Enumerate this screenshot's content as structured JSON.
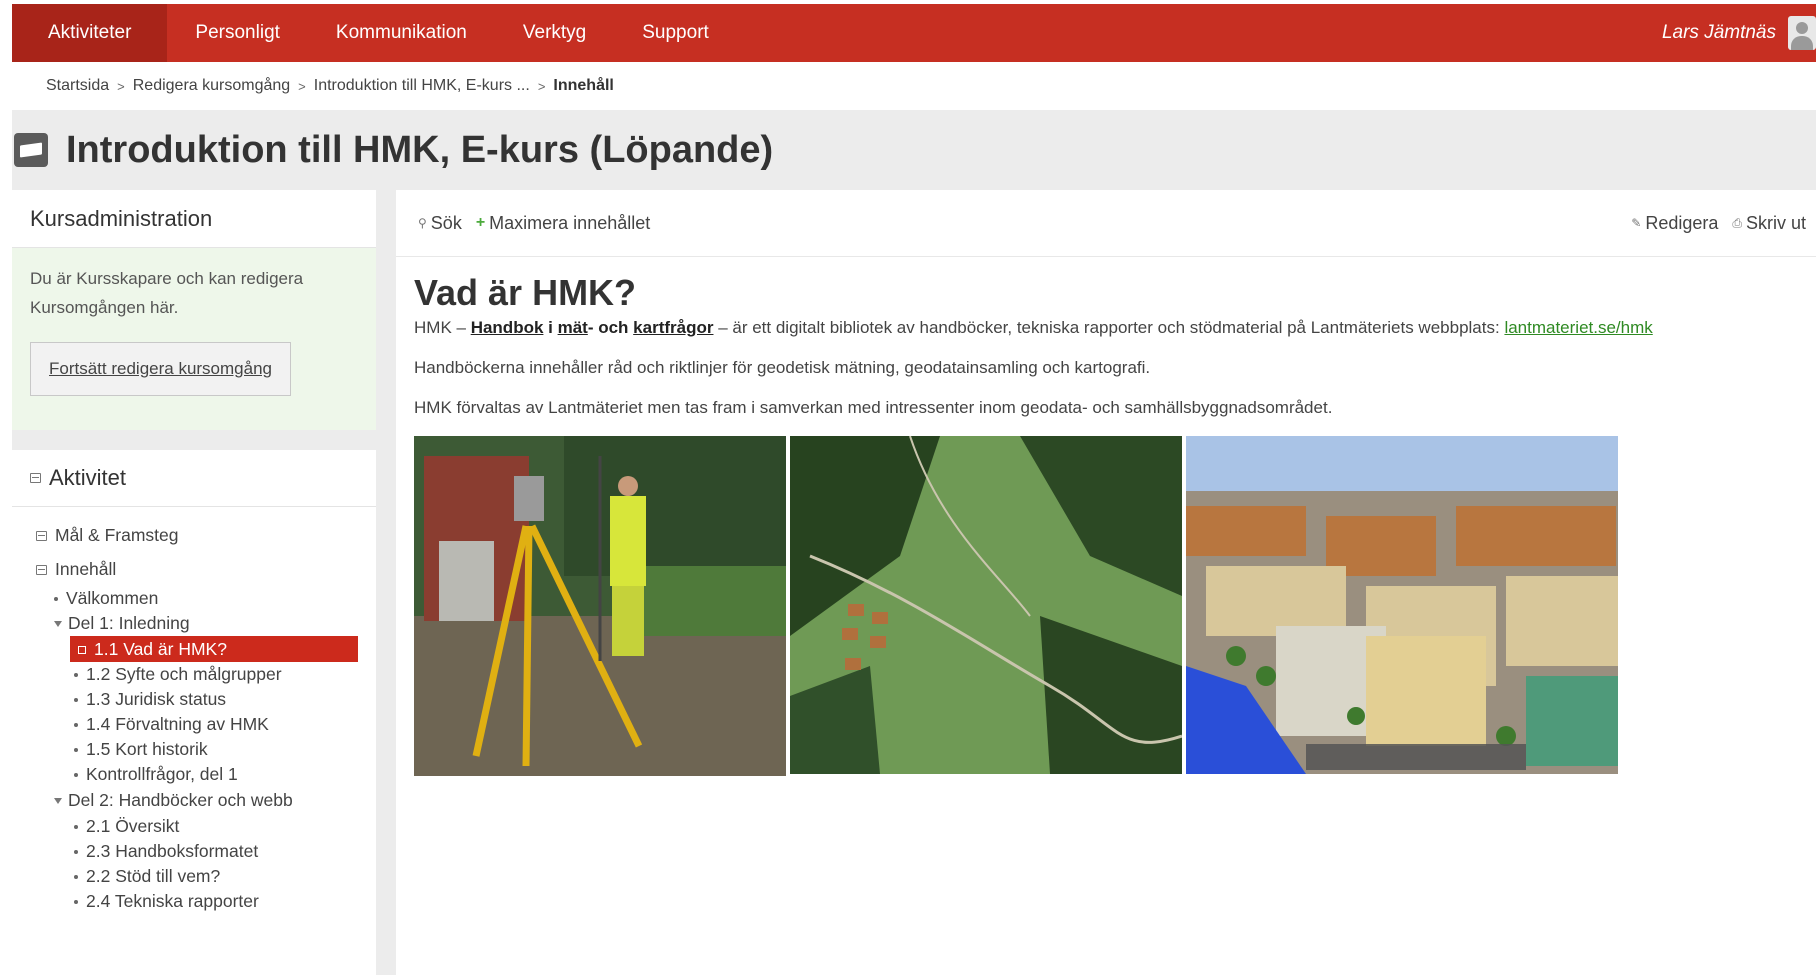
{
  "nav": {
    "items": [
      {
        "label": "Aktiviteter",
        "active": true
      },
      {
        "label": "Personligt"
      },
      {
        "label": "Kommunikation"
      },
      {
        "label": "Verktyg"
      },
      {
        "label": "Support"
      }
    ],
    "user_name": "Lars Jämtnäs",
    "accent_color": "#c62f22"
  },
  "breadcrumb": {
    "items": [
      "Startsida",
      "Redigera kursomgång",
      "Introduktion till HMK, E-kurs ..."
    ],
    "current": "Innehåll",
    "separator": ">"
  },
  "page": {
    "title": "Introduktion till HMK, E-kurs (Löpande)"
  },
  "admin": {
    "heading": "Kursadministration",
    "text_line1": "Du är Kursskapare och kan redigera",
    "text_line2": "Kursomgången här.",
    "button_label": "Fortsätt redigera kursomgång"
  },
  "activity": {
    "heading": "Aktivitet",
    "tree": [
      {
        "label": "Mål & Framsteg",
        "type": "section"
      },
      {
        "label": "Innehåll",
        "type": "section"
      },
      {
        "label": "Välkommen",
        "type": "item"
      },
      {
        "label": "Del 1: Inledning",
        "type": "group"
      },
      {
        "label": "1.1 Vad är HMK?",
        "type": "selected"
      },
      {
        "label": "1.2 Syfte och målgrupper",
        "type": "sub"
      },
      {
        "label": "1.3 Juridisk status",
        "type": "sub"
      },
      {
        "label": "1.4 Förvaltning av HMK",
        "type": "sub"
      },
      {
        "label": "1.5 Kort historik",
        "type": "sub"
      },
      {
        "label": "Kontrollfrågor, del 1",
        "type": "sub"
      },
      {
        "label": "Del 2: Handböcker och webb",
        "type": "group"
      },
      {
        "label": "2.1 Översikt",
        "type": "sub"
      },
      {
        "label": "2.3 Handboksformatet",
        "type": "sub"
      },
      {
        "label": "2.2 Stöd till vem?",
        "type": "sub"
      },
      {
        "label": "2.4 Tekniska rapporter",
        "type": "sub"
      }
    ]
  },
  "toolbar": {
    "search_label": "Sök",
    "maximize_label": "Maximera innehållet",
    "edit_label": "Redigera",
    "print_label": "Skriv ut"
  },
  "content": {
    "heading": "Vad är HMK?",
    "p1_prefix": "HMK – ",
    "p1_bold_1": "Handbok",
    "p1_bold_2": " i ",
    "p1_bold_3": "mät",
    "p1_bold_4": "- och ",
    "p1_bold_5": "kartfrågor",
    "p1_rest": " – är ett digitalt bibliotek av handböcker, tekniska rapporter och stödmaterial på Lantmäteriets webbplats: ",
    "p1_link": "lantmateriet.se/hmk",
    "p2": "Handböckerna innehåller råd och riktlinjer för geodetisk mätning, geodatainsamling och kartografi.",
    "p3": "HMK förvaltas av Lantmäteriet men tas fram i samverkan med intressenter inom geodata- och samhällsbyggnadsområdet.",
    "images": [
      "surveyor-photo",
      "aerial-photo",
      "minecraft-city-render"
    ],
    "link_color": "#2f8a23"
  }
}
